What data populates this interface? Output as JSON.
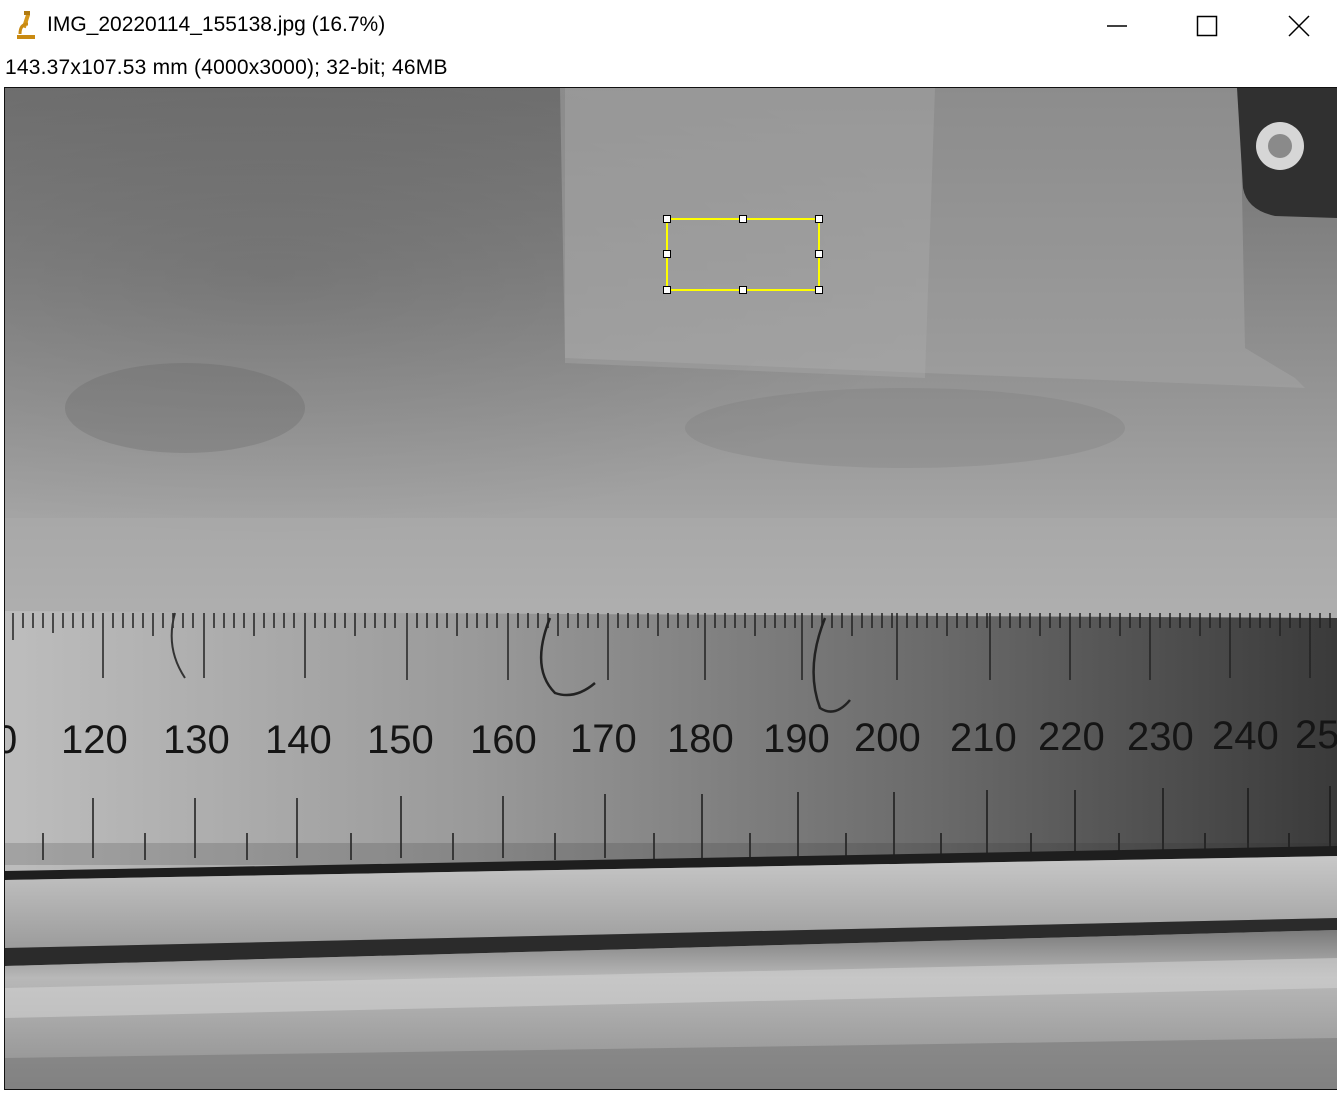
{
  "window": {
    "title": "IMG_20220114_155138.jpg (16.7%)",
    "icon": "imagej-microscope-icon",
    "controls": {
      "minimize_icon": "minimize-icon",
      "maximize_icon": "maximize-icon",
      "close_icon": "close-icon"
    }
  },
  "image_info": "143.37x107.53 mm (4000x3000); 32-bit; 46MB",
  "image": {
    "type": "grayscale photograph of a metal ruler",
    "ruler_labels": [
      "0",
      "120",
      "130",
      "140",
      "150",
      "160",
      "170",
      "180",
      "190",
      "200",
      "210",
      "220",
      "230",
      "240",
      "25"
    ]
  },
  "selection": {
    "shape": "rectangle",
    "color": "#ffff00",
    "handle_color": "#ffffff"
  },
  "colors": {
    "selection_stroke": "#ffff00"
  }
}
